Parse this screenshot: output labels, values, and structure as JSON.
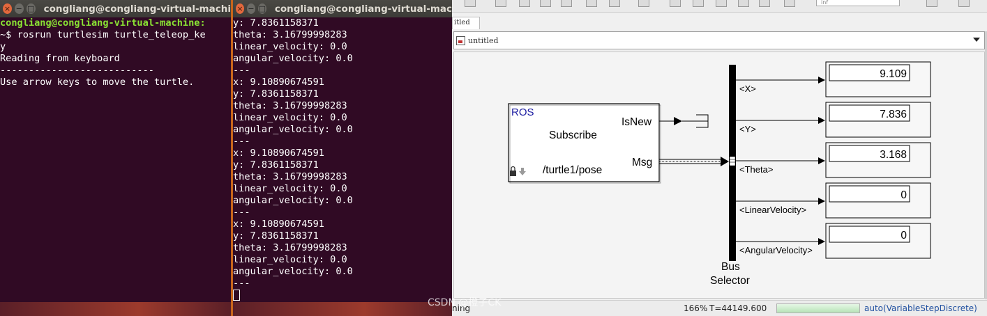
{
  "terminal1": {
    "title": "congliang@congliang-virtual-machi",
    "prompt_user": "congliang@congliang-virtual-machine:",
    "prompt_path": "~$ ",
    "command": "rosrun turtlesim turtle_teleop_ke",
    "command_wrap": "y",
    "output": [
      "Reading from keyboard",
      "---------------------------",
      "Use arrow keys to move the turtle."
    ]
  },
  "terminal2": {
    "title": "congliang@congliang-virtual-mac",
    "lines": [
      "y: 7.8361158371",
      "theta: 3.16799998283",
      "linear_velocity: 0.0",
      "angular_velocity: 0.0",
      "---",
      "x: 9.10890674591",
      "y: 7.8361158371",
      "theta: 3.16799998283",
      "linear_velocity: 0.0",
      "angular_velocity: 0.0",
      "---",
      "x: 9.10890674591",
      "y: 7.8361158371",
      "theta: 3.16799998283",
      "linear_velocity: 0.0",
      "angular_velocity: 0.0",
      "---",
      "x: 9.10890674591",
      "y: 7.8361158371",
      "theta: 3.16799998283",
      "linear_velocity: 0.0",
      "angular_velocity: 0.0",
      "---"
    ]
  },
  "window_buttons": {
    "close": "×",
    "minimize": "−",
    "maximize": "□"
  },
  "simulink": {
    "tab_label": "itled",
    "breadcrumb": "untitled",
    "toolbar_field": "inf",
    "subscribe_block": {
      "library": "ROS",
      "name": "Subscribe",
      "topic": "/turtle1/pose",
      "port_isnew": "IsNew",
      "port_msg": "Msg"
    },
    "bus_selector": {
      "label_line1": "Bus",
      "label_line2": "Selector",
      "outputs": [
        "<X>",
        "<Y>",
        "<Theta>",
        "<LinearVelocity>",
        "<AngularVelocity>"
      ]
    },
    "displays": [
      "9.109",
      "7.836",
      "3.168",
      "0",
      "0"
    ],
    "status": {
      "left": "ning",
      "zoom": "166%",
      "time": "T=44149.600",
      "progress": 1.0,
      "solver": "auto(VariableStepDiscrete)"
    }
  },
  "watermark": "CSDN @橙子CK",
  "colors": {
    "terminal_bg": "#300a24",
    "prompt_green": "#8ae234",
    "ros_blue": "#1a1aa0",
    "solver_blue": "#1f4fa0"
  }
}
